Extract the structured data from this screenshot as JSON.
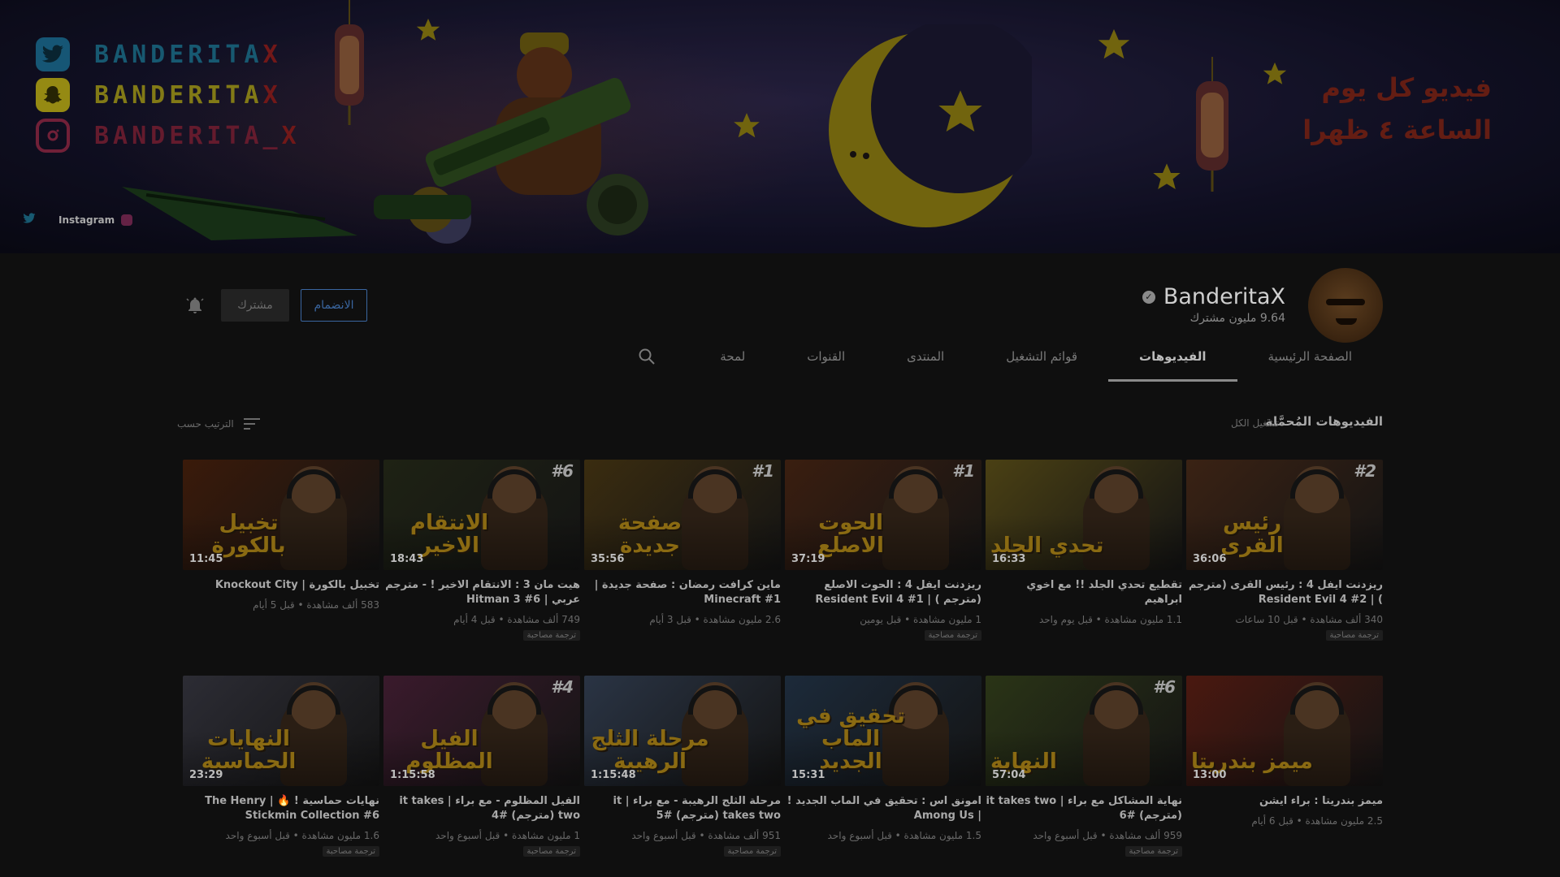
{
  "banner": {
    "socials": [
      {
        "icon": "twitter-icon",
        "handle": "BANDERITA",
        "suffix": "X"
      },
      {
        "icon": "snapchat-icon",
        "handle": "BANDERITA",
        "suffix": "X"
      },
      {
        "icon": "instagram-icon",
        "handle": "BANDERITA_",
        "suffix": "X"
      }
    ],
    "link_label": "Instagram",
    "arabic_line1": "فيديو كل يوم",
    "arabic_line2": "الساعة ٤ ظهرا"
  },
  "channel": {
    "name": "BanderitaX",
    "subscribers": "9.64 مليون مشترك",
    "join_label": "الانضمام",
    "subscribed_label": "مشترك"
  },
  "tabs": [
    {
      "label": "الصفحة الرئيسية",
      "active": false
    },
    {
      "label": "الفيديوهات",
      "active": true
    },
    {
      "label": "قوائم التشغيل",
      "active": false
    },
    {
      "label": "المنتدى",
      "active": false
    },
    {
      "label": "القنوات",
      "active": false
    },
    {
      "label": "لمحة",
      "active": false
    }
  ],
  "section": {
    "title": "الفيديوهات المُحمَّلة",
    "play_all": "تشغيل الكل",
    "sort_by": "الترتيب حسب"
  },
  "videos": [
    {
      "title": "ريزدنت ايفل 4 : رئيس القرى (مترجم ) | Resident Evil 4 #2",
      "meta": "340 ألف مشاهدة • قبل 10 ساعات",
      "duration": "36:06",
      "rank": "#2",
      "caption": "رئيس القرى",
      "cc": "ترجمة مصاحبة",
      "color": "#3a2214"
    },
    {
      "title": "تقطيع تحدي الجلد !! مع اخوي ابراهيم",
      "meta": "1.1 مليون مشاهدة • قبل يوم واحد",
      "duration": "16:33",
      "rank": "",
      "caption": "تحدي الجلد",
      "cc": "",
      "color": "#4a4014"
    },
    {
      "title": "ريزدنت ايفل 4 : الحوت الاصلع (مترجم ) | Resident Evil 4 #1",
      "meta": "1 مليون مشاهدة • قبل يومين",
      "duration": "37:19",
      "rank": "#1",
      "caption": "الحوت الاصلع",
      "cc": "ترجمة مصاحبة",
      "color": "#3a1e10"
    },
    {
      "title": "ماين كرافت رمضان : صفحة جديدة | Minecraft #1",
      "meta": "2.6 مليون مشاهدة • قبل 3 أيام",
      "duration": "35:56",
      "rank": "#1",
      "caption": "صفحة جديدة",
      "cc": "",
      "color": "#3a2c10"
    },
    {
      "title": "هيت مان 3 : الانتقام الاخير ! - مترجم عربي | Hitman 3 #6",
      "meta": "749 ألف مشاهدة • قبل 4 أيام",
      "duration": "18:43",
      "rank": "#6",
      "caption": "الانتقام الاخير",
      "cc": "ترجمة مصاحبة",
      "color": "#1e2214"
    },
    {
      "title": "تخبيل بالكورة | Knockout City",
      "meta": "583 ألف مشاهدة • قبل 5 أيام",
      "duration": "11:45",
      "rank": "",
      "caption": "تخبيل بالكورة",
      "cc": "",
      "color": "#3a1a0a"
    },
    {
      "title": "ميمز بندريتا : براء ايشن",
      "meta": "2.5 مليون مشاهدة • قبل 6 أيام",
      "duration": "13:00",
      "rank": "",
      "caption": "ميمز بندريتا",
      "cc": "",
      "color": "#4a1810"
    },
    {
      "title": "نهاية المشاكل مع براء | it takes two (مترجم) #6",
      "meta": "959 ألف مشاهدة • قبل أسبوع واحد",
      "duration": "57:04",
      "rank": "#6",
      "caption": "النهاية",
      "cc": "ترجمة مصاحبة",
      "color": "#2a3416"
    },
    {
      "title": "امونق اس : تحقيق في الماب الجديد ! | Among Us",
      "meta": "1.5 مليون مشاهدة • قبل أسبوع واحد",
      "duration": "15:31",
      "rank": "",
      "caption": "تحقيق في الماب الجديد",
      "cc": "",
      "color": "#1c2a3a"
    },
    {
      "title": "مرحلة الثلج الرهيبة - مع براء | it takes two (مترجم) #5",
      "meta": "951 ألف مشاهدة • قبل أسبوع واحد",
      "duration": "1:15:48",
      "rank": "",
      "caption": "مرحلة الثلج الرهيبة",
      "cc": "ترجمة مصاحبة",
      "color": "#2a3444"
    },
    {
      "title": "الفيل المظلوم - مع براء | it takes two (مترجم) #4",
      "meta": "1 مليون مشاهدة • قبل أسبوع واحد",
      "duration": "1:15:58",
      "rank": "#4",
      "caption": "الفيل المظلوم",
      "cc": "ترجمة مصاحبة",
      "color": "#3a1a2c"
    },
    {
      "title": "نهايات حماسية ! 🔥 | The Henry Stickmin Collection #6",
      "meta": "1.6 مليون مشاهدة • قبل أسبوع واحد",
      "duration": "23:29",
      "rank": "",
      "caption": "النهايات الحماسية",
      "cc": "ترجمة مصاحبة",
      "color": "#2c2c34"
    }
  ],
  "colors": {
    "background": "#0f0f0f",
    "join_blue": "#3a66a0",
    "caption_gold": "#8a6a12"
  }
}
